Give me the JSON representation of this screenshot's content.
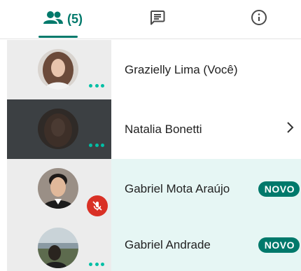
{
  "tabs": [
    {
      "id": "people",
      "icon": "people-icon",
      "count_label": "(5)",
      "active": true
    },
    {
      "id": "chat",
      "icon": "chat-icon",
      "active": false
    },
    {
      "id": "info",
      "icon": "info-icon",
      "active": false
    }
  ],
  "participants": [
    {
      "name": "Grazielly Lima (Você)",
      "status": "more-dots"
    },
    {
      "name": "Natalia Bonetti",
      "status": "more-dots",
      "action": "chevron-right-icon"
    },
    {
      "name": "Gabriel Mota Araújo",
      "status": "mic-muted-icon",
      "badge": "NOVO"
    },
    {
      "name": "Gabriel Andrade",
      "status": "more-dots",
      "badge": "NOVO"
    }
  ],
  "colors": {
    "accent": "#00796b",
    "dots": "#00bfa5",
    "highlight": "#e6f6f4",
    "muted": "#d93025"
  }
}
